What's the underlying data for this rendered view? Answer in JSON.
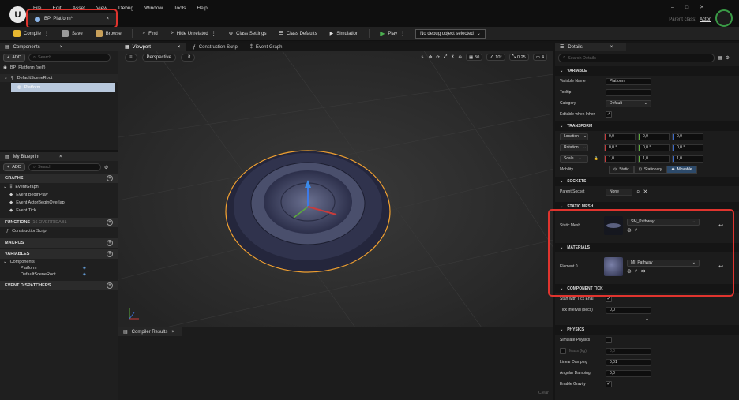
{
  "menu": [
    "File",
    "Edit",
    "Asset",
    "View",
    "Debug",
    "Window",
    "Tools",
    "Help"
  ],
  "doc_tab": {
    "title": "BP_Platform*",
    "close": "×"
  },
  "window_controls": {
    "minimize": "–",
    "restore": "□",
    "close": "✕"
  },
  "parent_class": {
    "label": "Parent class:",
    "value": "Actor"
  },
  "toolbar": {
    "compile": "Compile",
    "save": "Save",
    "browse": "Browse",
    "find": "Find",
    "hide_unrelated": "Hide Unrelated",
    "class_settings": "Class Settings",
    "class_defaults": "Class Defaults",
    "simulation": "Simulation",
    "play": "Play",
    "debug_select": "No debug object selected"
  },
  "components": {
    "tab": "Components",
    "add": "ADD",
    "search_placeholder": "Search",
    "self": "BP_Platform (self)",
    "root": "DefaultSceneRoot",
    "child": "Platform"
  },
  "my_blueprint": {
    "tab": "My Blueprint",
    "add": "ADD",
    "search_placeholder": "Search",
    "graphs_header": "GRAPHS",
    "event_graph": "EventGraph",
    "events": [
      "Event BeginPlay",
      "Event ActorBeginOverlap",
      "Event Tick"
    ],
    "functions_header": "FUNCTIONS",
    "functions_sub": "(16 OVERRIDABL",
    "construction_script": "ConstructionScript",
    "macros_header": "MACROS",
    "variables_header": "VARIABLES",
    "components_label": "Components",
    "vars": [
      "Platform",
      "DefaultSceneRoot"
    ],
    "dispatchers_header": "EVENT DISPATCHERS"
  },
  "viewport": {
    "tabs": [
      "Viewport",
      "Construction Scrip",
      "Event Graph"
    ],
    "perspective": "Perspective",
    "lit": "Lit",
    "grid": "50",
    "angle": "10°",
    "scale": "0.25",
    "cams": "4"
  },
  "compiler": {
    "tab": "Compiler Results",
    "clear": "Clear"
  },
  "details": {
    "tab": "Details",
    "search_placeholder": "Search Details",
    "variable": {
      "header": "VARIABLE",
      "name_label": "Variable Name",
      "name_value": "Platform",
      "tooltip_label": "Tooltip",
      "category_label": "Category",
      "category_value": "Default",
      "editable_label": "Editable when Inher"
    },
    "transform": {
      "header": "TRANSFORM",
      "rows": [
        {
          "label": "Location",
          "x": "0,0",
          "y": "0,0",
          "z": "0,0"
        },
        {
          "label": "Rotation",
          "x": "0,0 °",
          "y": "0,0 °",
          "z": "0,0 °"
        },
        {
          "label": "Scale",
          "x": "1,0",
          "y": "1,0",
          "z": "1,0"
        }
      ],
      "mobility_label": "Mobility",
      "mobility": [
        "Static",
        "Stationary",
        "Movable"
      ]
    },
    "sockets": {
      "header": "SOCKETS",
      "parent_label": "Parent Socket",
      "parent_value": "None"
    },
    "static_mesh": {
      "header": "STATIC MESH",
      "label": "Static Mesh",
      "value": "SM_Pathway"
    },
    "materials": {
      "header": "MATERIALS",
      "label": "Element 0",
      "value": "MI_Pathway"
    },
    "component_tick": {
      "header": "COMPONENT TICK",
      "start_label": "Start with Tick Enal",
      "interval_label": "Tick Interval (secs)",
      "interval_value": "0,0"
    },
    "physics": {
      "header": "PHYSICS",
      "simulate_label": "Simulate Physics",
      "mass_label": "Mass (kg)",
      "mass_value": "0,0",
      "linear_label": "Linear Damping",
      "linear_value": "0,01",
      "angular_label": "Angular Damping",
      "angular_value": "0,0",
      "gravity_label": "Enable Gravity"
    }
  },
  "colors": {
    "accent": "#e0342e",
    "movable": "#2d4a6a",
    "play": "#4caf50",
    "selection": "#f0a030"
  }
}
